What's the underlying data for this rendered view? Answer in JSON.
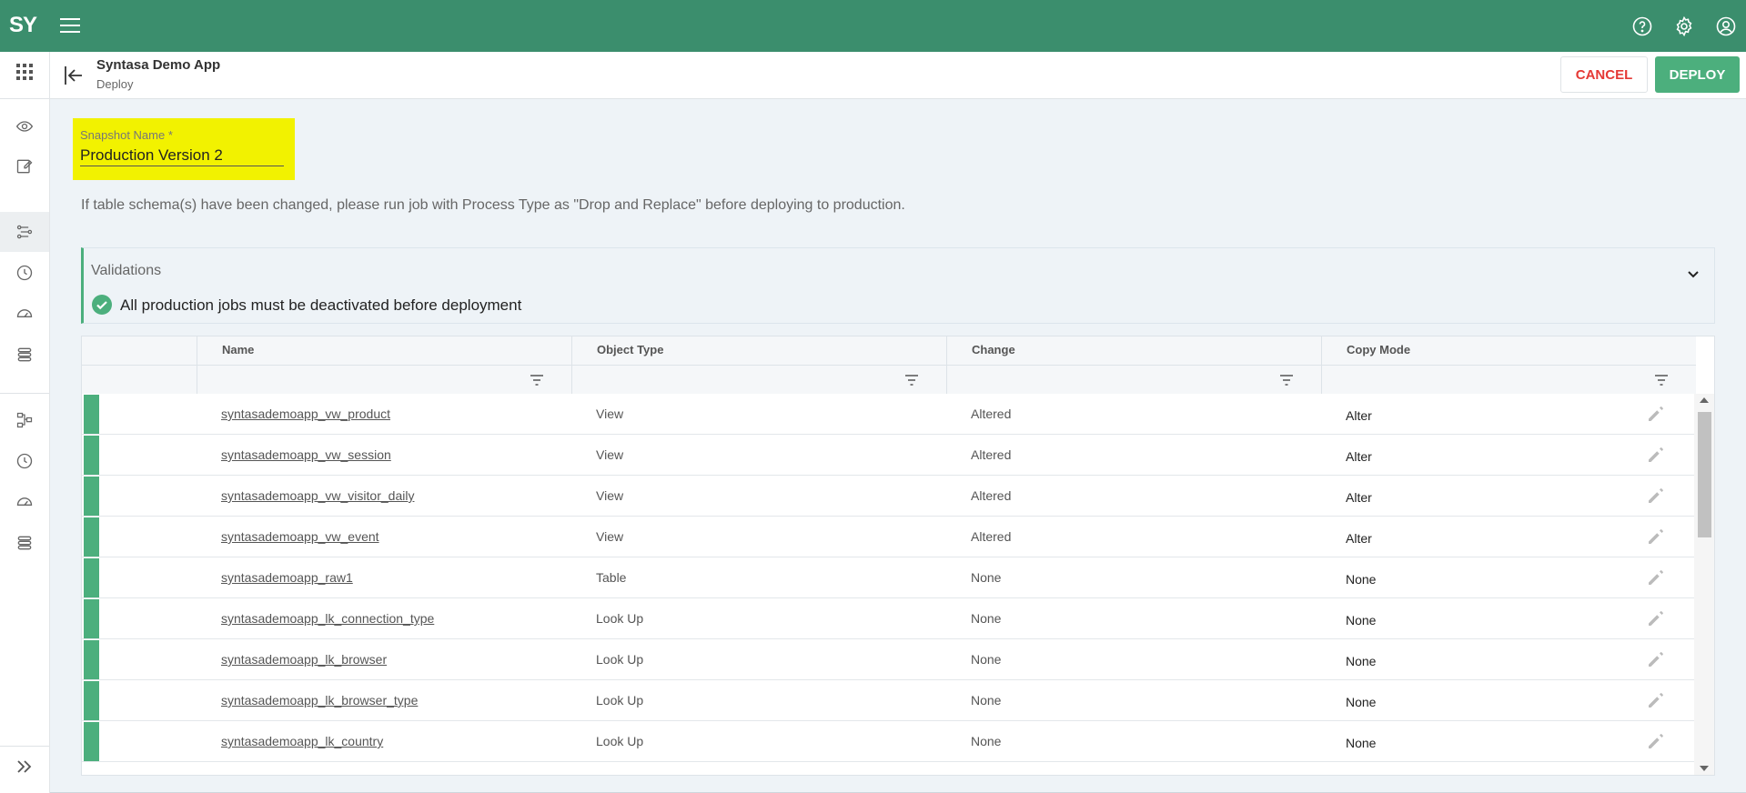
{
  "header": {
    "logo_text": "SY",
    "brand_color": "#3b8e6d"
  },
  "subheader": {
    "app_title": "Syntasa Demo App",
    "app_subtitle": "Deploy",
    "cancel_label": "CANCEL",
    "deploy_label": "DEPLOY"
  },
  "snapshot": {
    "label": "Snapshot Name *",
    "value": "Production Version 2"
  },
  "info_text": "If table schema(s) have been changed, please run job with Process Type as \"Drop and Replace\" before deploying to production.",
  "validations": {
    "title": "Validations",
    "items": [
      "All production jobs must be deactivated before deployment"
    ]
  },
  "table": {
    "columns": [
      "Name",
      "Object Type",
      "Change",
      "Copy Mode"
    ],
    "rows": [
      {
        "name": "syntasademoapp_vw_product",
        "type": "View",
        "change": "Altered",
        "copy": "Alter"
      },
      {
        "name": "syntasademoapp_vw_session",
        "type": "View",
        "change": "Altered",
        "copy": "Alter"
      },
      {
        "name": "syntasademoapp_vw_visitor_daily",
        "type": "View",
        "change": "Altered",
        "copy": "Alter"
      },
      {
        "name": "syntasademoapp_vw_event",
        "type": "View",
        "change": "Altered",
        "copy": "Alter"
      },
      {
        "name": "syntasademoapp_raw1",
        "type": "Table",
        "change": "None",
        "copy": "None"
      },
      {
        "name": "syntasademoapp_lk_connection_type",
        "type": "Look Up",
        "change": "None",
        "copy": "None"
      },
      {
        "name": "syntasademoapp_lk_browser",
        "type": "Look Up",
        "change": "None",
        "copy": "None"
      },
      {
        "name": "syntasademoapp_lk_browser_type",
        "type": "Look Up",
        "change": "None",
        "copy": "None"
      },
      {
        "name": "syntasademoapp_lk_country",
        "type": "Look Up",
        "change": "None",
        "copy": "None"
      }
    ]
  },
  "icons": {
    "top": [
      "help-icon",
      "settings-icon",
      "account-icon"
    ],
    "rail": [
      "apps-grid-icon",
      "eye-icon",
      "edit-note-icon",
      "pipeline-icon",
      "history-icon",
      "speedometer-icon",
      "stack-icon",
      "workflow-icon",
      "history-icon",
      "speedometer-icon",
      "stack-icon"
    ]
  }
}
